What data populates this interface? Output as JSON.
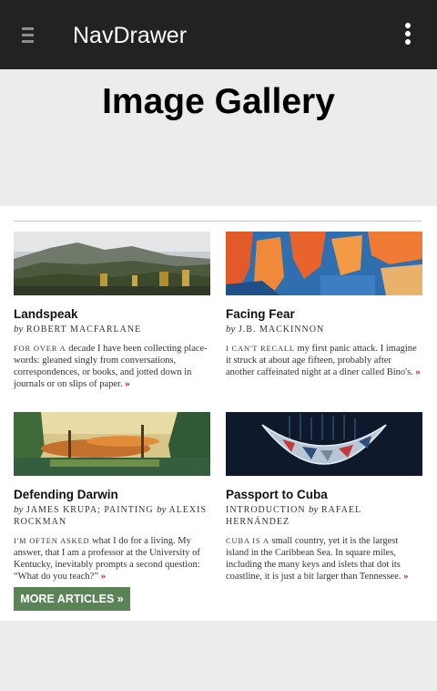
{
  "appbar": {
    "title": "NavDrawer"
  },
  "page": {
    "title": "Image Gallery"
  },
  "articles": [
    {
      "title": "Landspeak",
      "byline_prefix": "by",
      "author": "ROBERT MACFARLANE",
      "lead": "FOR OVER A",
      "excerpt": " decade I have been collecting place-words: gleaned singly from conversations, correspondences, or books, and jotted down in journals or on slips of paper.",
      "more": "»"
    },
    {
      "title": "Facing Fear",
      "byline_prefix": "by",
      "author": "J.B. MACKINNON",
      "lead": "I CAN'T RECALL",
      "excerpt": " my first panic attack. I imagine it struck at about age fifteen, probably after another caffeinated night at a diner called Bino's.",
      "more": "»"
    },
    {
      "title": "Defending Darwin",
      "byline_prefix": "by",
      "author": "JAMES KRUPA; PAINTING",
      "byline_prefix_2": "by",
      "author_2": "ALEXIS ROCKMAN",
      "lead": "I'M OFTEN ASKED",
      "excerpt": " what I do for a living. My answer, that I am a professor at the University of Kentucky, inevitably prompts a second question: “What do you teach?”",
      "more": "»"
    },
    {
      "title": "Passport to Cuba",
      "byline_pre": "INTRODUCTION",
      "byline_prefix": "by",
      "author": "RAFAEL HERNÁNDEZ",
      "lead": "CUBA IS A",
      "excerpt": " small country, yet it is the largest island in the Caribbean Sea. In square miles, including the many keys and islets that dot its coastline, it is just a bit larger than Tennessee.",
      "more": "»"
    }
  ],
  "more_articles": {
    "label": "MORE ARTICLES »"
  },
  "colors": {
    "appbar": "#222222",
    "background": "#ececec",
    "button": "#5a8456",
    "more_arrow": "#a31c1c"
  },
  "icons": {
    "menu": "menu-icon",
    "overflow": "more-vert-icon"
  }
}
